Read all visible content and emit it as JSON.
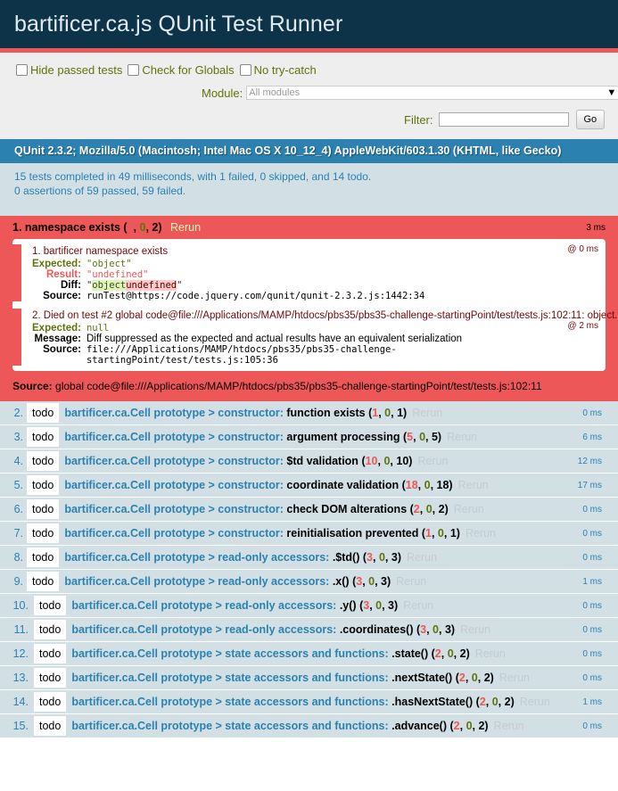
{
  "header": {
    "title": "bartificer.ca.js QUnit Test Runner"
  },
  "toolbar": {
    "hide_passed": "Hide passed tests",
    "check_globals": "Check for Globals",
    "no_try_catch": "No try-catch",
    "module_label": "Module:",
    "module_value": "All modules",
    "filter_label": "Filter:",
    "filter_value": "",
    "go_label": "Go"
  },
  "user_agent": "QUnit 2.3.2; Mozilla/5.0 (Macintosh; Intel Mac OS X 10_12_4) AppleWebKit/603.1.30 (KHTML, like Gecko)",
  "result": {
    "line1": "15 tests completed in 49 milliseconds, with 1 failed, 0 skipped, and 14 todo.",
    "line2": "0 assertions of 59 passed, 59 failed."
  },
  "failed_test": {
    "number": "1.",
    "name": "namespace exists",
    "fail": "2",
    "pass": "0",
    "total": "2",
    "rerun": "Rerun",
    "runtime": "3 ms",
    "assertions": [
      {
        "message": "1. bartificer namespace exists",
        "runtime": "@ 0 ms",
        "expected_label": "Expected:",
        "expected": "\"object\"",
        "result_label": "Result:",
        "result": "\"undefined\"",
        "diff_label": "Diff:",
        "diff_q1": "\"",
        "diff_ins": "object",
        "diff_del": "undefined",
        "diff_q2": "\"",
        "source_label": "Source:",
        "source": "runTest@https://code.jquery.com/qunit/qunit-2.3.2.js:1442:34"
      },
      {
        "message": "2. Died on test #2 global code@file:///Applications/MAMP/htdocs/pbs35/pbs35-challenge-startingPoint/test/tests.js:102:11: object...",
        "runtime": "@ 2 ms",
        "expected_label": "Expected:",
        "expected": "null",
        "message_label": "Message:",
        "message_value": "Diff suppressed as the expected and actual results have an equivalent serialization",
        "source_label": "Source:",
        "source_1": "file:///Applications/MAMP/htdocs/pbs35/pbs35-challenge-",
        "source_2": "startingPoint/test/tests.js:105:36"
      }
    ],
    "source_label": "Source:",
    "source": "global code@file:///Applications/MAMP/htdocs/pbs35/pbs35-challenge-startingPoint/test/tests.js:102:11"
  },
  "todo_tests": [
    {
      "num": "2.",
      "badge": "todo",
      "module": "bartificer.ca.Cell prototype > constructor:",
      "name": "function exists",
      "fail": "1",
      "pass": "0",
      "total": "1",
      "rerun": "Rerun",
      "runtime": "0 ms"
    },
    {
      "num": "3.",
      "badge": "todo",
      "module": "bartificer.ca.Cell prototype > constructor:",
      "name": "argument processing",
      "fail": "5",
      "pass": "0",
      "total": "5",
      "rerun": "Rerun",
      "runtime": "6 ms"
    },
    {
      "num": "4.",
      "badge": "todo",
      "module": "bartificer.ca.Cell prototype > constructor:",
      "name": "$td validation",
      "fail": "10",
      "pass": "0",
      "total": "10",
      "rerun": "Rerun",
      "runtime": "12 ms"
    },
    {
      "num": "5.",
      "badge": "todo",
      "module": "bartificer.ca.Cell prototype > constructor:",
      "name": "coordinate validation",
      "fail": "18",
      "pass": "0",
      "total": "18",
      "rerun": "Rerun",
      "runtime": "17 ms"
    },
    {
      "num": "6.",
      "badge": "todo",
      "module": "bartificer.ca.Cell prototype > constructor:",
      "name": "check DOM alterations",
      "fail": "2",
      "pass": "0",
      "total": "2",
      "rerun": "Rerun",
      "runtime": "0 ms"
    },
    {
      "num": "7.",
      "badge": "todo",
      "module": "bartificer.ca.Cell prototype > constructor:",
      "name": "reinitialisation prevented",
      "fail": "1",
      "pass": "0",
      "total": "1",
      "rerun": "Rerun",
      "runtime": "0 ms"
    },
    {
      "num": "8.",
      "badge": "todo",
      "module": "bartificer.ca.Cell prototype > read-only accessors:",
      "name": ".$td()",
      "fail": "3",
      "pass": "0",
      "total": "3",
      "rerun": "Rerun",
      "runtime": "0 ms"
    },
    {
      "num": "9.",
      "badge": "todo",
      "module": "bartificer.ca.Cell prototype > read-only accessors:",
      "name": ".x()",
      "fail": "3",
      "pass": "0",
      "total": "3",
      "rerun": "Rerun",
      "runtime": "1 ms"
    },
    {
      "num": "10.",
      "badge": "todo",
      "module": "bartificer.ca.Cell prototype > read-only accessors:",
      "name": ".y()",
      "fail": "3",
      "pass": "0",
      "total": "3",
      "rerun": "Rerun",
      "runtime": "0 ms"
    },
    {
      "num": "11.",
      "badge": "todo",
      "module": "bartificer.ca.Cell prototype > read-only accessors:",
      "name": ".coordinates()",
      "fail": "3",
      "pass": "0",
      "total": "3",
      "rerun": "Rerun",
      "runtime": "0 ms"
    },
    {
      "num": "12.",
      "badge": "todo",
      "module": "bartificer.ca.Cell prototype > state accessors and functions:",
      "name": ".state()",
      "fail": "2",
      "pass": "0",
      "total": "2",
      "rerun": "Rerun",
      "runtime": "0 ms"
    },
    {
      "num": "13.",
      "badge": "todo",
      "module": "bartificer.ca.Cell prototype > state accessors and functions:",
      "name": ".nextState()",
      "fail": "2",
      "pass": "0",
      "total": "2",
      "rerun": "Rerun",
      "runtime": "0 ms"
    },
    {
      "num": "14.",
      "badge": "todo",
      "module": "bartificer.ca.Cell prototype > state accessors and functions:",
      "name": ".hasNextState()",
      "fail": "2",
      "pass": "0",
      "total": "2",
      "rerun": "Rerun",
      "runtime": "1 ms"
    },
    {
      "num": "15.",
      "badge": "todo",
      "module": "bartificer.ca.Cell prototype > state accessors and functions:",
      "name": ".advance()",
      "fail": "2",
      "pass": "0",
      "total": "2",
      "rerun": "Rerun",
      "runtime": "0 ms"
    }
  ],
  "colors": {
    "header_bg": "#0d3349",
    "fail_red": "#ee5757",
    "pass_green": "#5e740b",
    "banner_blue": "#2b81af",
    "todo_bg": "#d2e0e6"
  }
}
